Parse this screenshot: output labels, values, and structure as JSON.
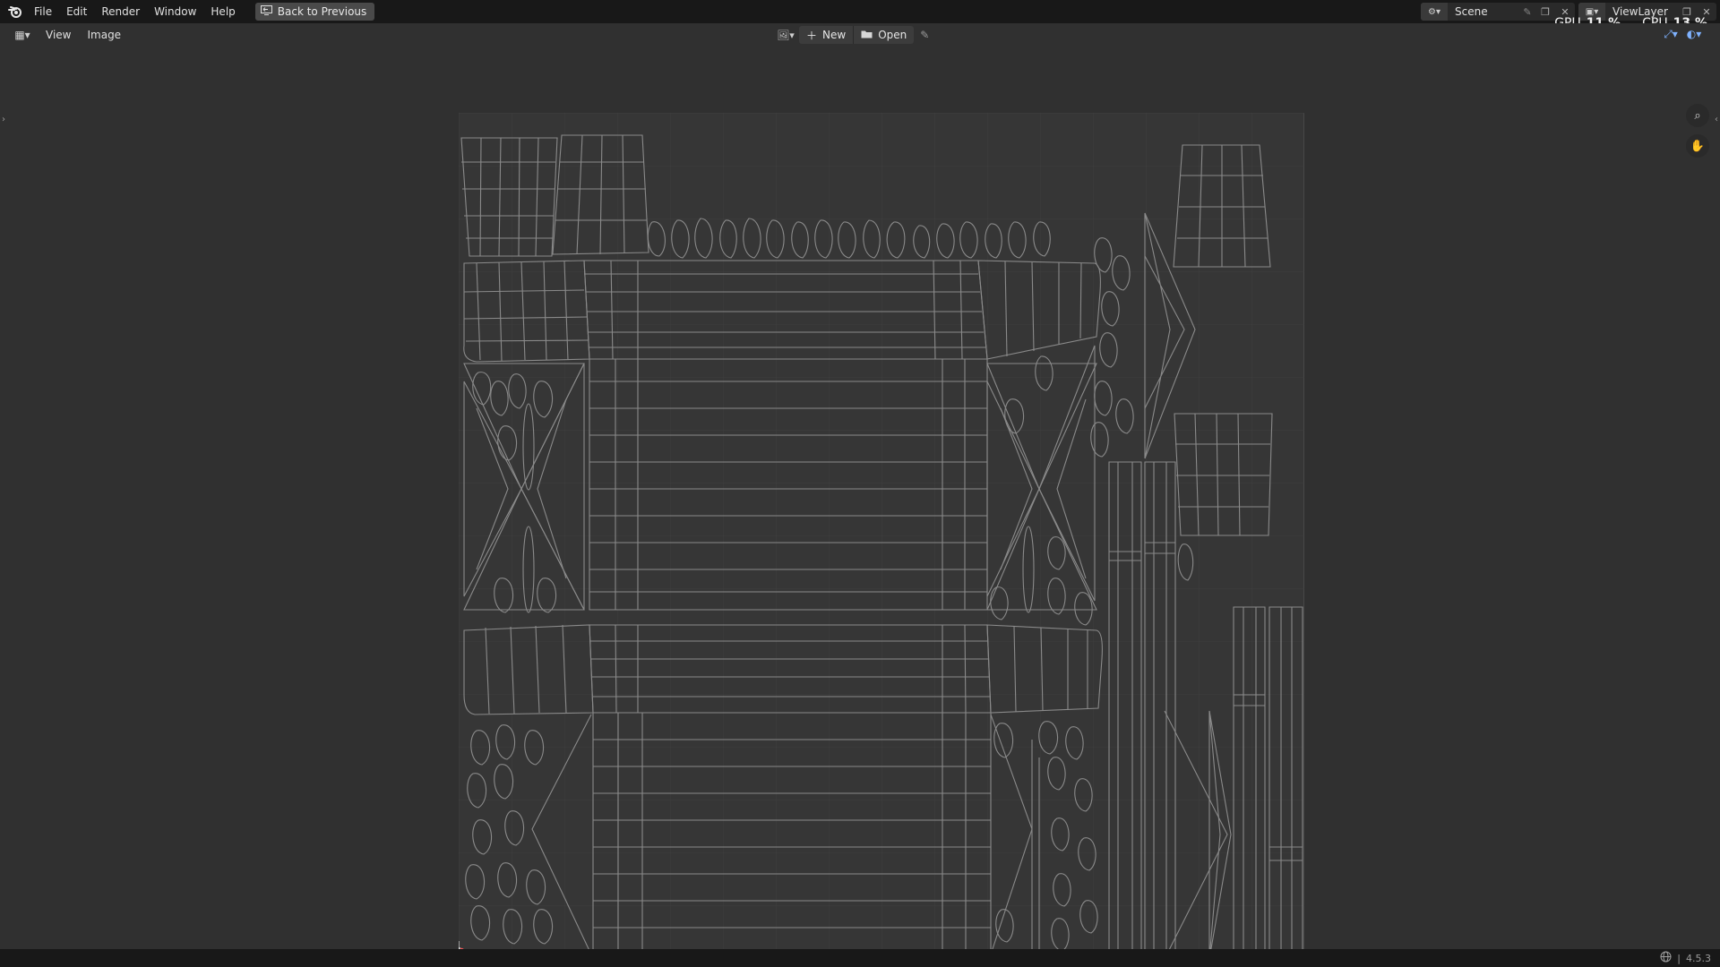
{
  "topbar": {
    "menus": [
      "File",
      "Edit",
      "Render",
      "Window",
      "Help"
    ],
    "back_button": "Back to Previous",
    "scene": "Scene",
    "view_layer": "ViewLayer"
  },
  "stats": {
    "gpu_label": "GPU",
    "gpu_value": "11 %",
    "cpu_label": "CPU",
    "cpu_value": "13 %"
  },
  "editor_header": {
    "menus": [
      "View",
      "Image"
    ],
    "new_label": "New",
    "open_label": "Open"
  },
  "statusbar": {
    "version": "4.5.3"
  },
  "colors": {
    "background": "#303030",
    "topbar": "#181818",
    "uv_area": "#383838",
    "uv_line": "#8a8a8a",
    "accent_blue": "#7fb2ff"
  }
}
